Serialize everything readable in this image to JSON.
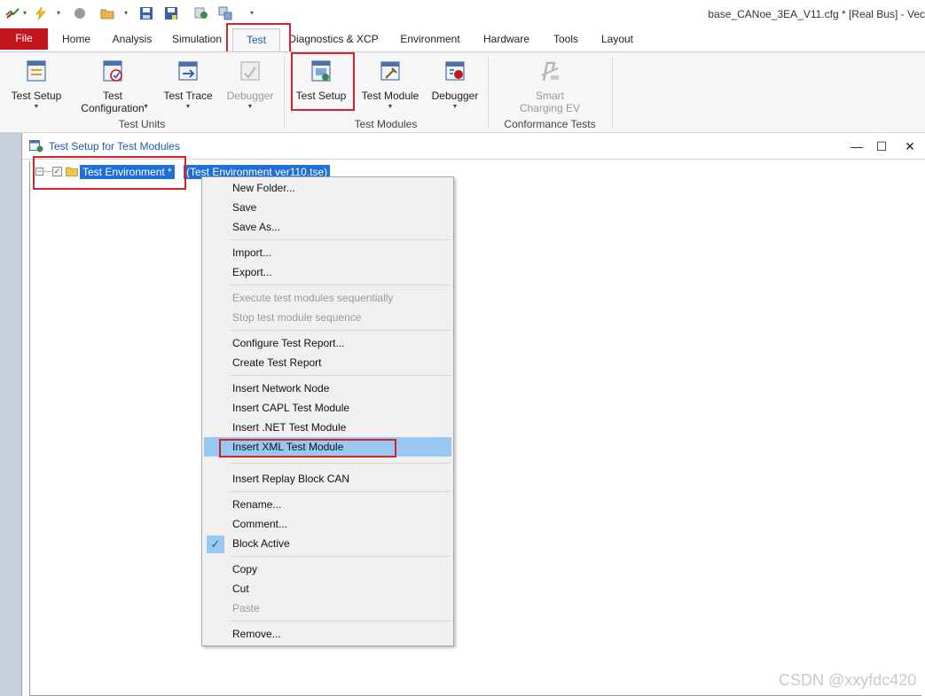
{
  "window_title": "base_CANoe_3EA_V11.cfg * [Real Bus] - Vec",
  "quick_access": [
    {
      "icon": "canoe-logo-icon"
    },
    {
      "icon": "lightning-icon"
    },
    {
      "icon": "record-stop-icon"
    },
    {
      "icon": "open-folder-icon"
    },
    {
      "icon": "save-icon"
    },
    {
      "icon": "save-as-icon"
    },
    {
      "icon": "database-icon"
    },
    {
      "icon": "configure-icon"
    }
  ],
  "menu_tabs": {
    "file": "File",
    "home": "Home",
    "analysis": "Analysis",
    "simulation": "Simulation",
    "test": "Test",
    "diagnostics": "Diagnostics & XCP",
    "environment": "Environment",
    "hardware": "Hardware",
    "tools": "Tools",
    "layout": "Layout",
    "active": "Test"
  },
  "ribbon": {
    "test_units": {
      "group_label": "Test Units",
      "test_setup": "Test Setup",
      "test_configuration_1": "Test",
      "test_configuration_2": "Configuration",
      "test_trace": "Test Trace",
      "debugger": "Debugger"
    },
    "test_modules": {
      "group_label": "Test Modules",
      "test_setup": "Test Setup",
      "test_module": "Test Module",
      "debugger": "Debugger"
    },
    "conformance": {
      "group_label": "Conformance Tests",
      "smart_charging_1": "Smart",
      "smart_charging_2": "Charging EV"
    }
  },
  "panel": {
    "title": "Test Setup for Test Modules",
    "minimize": "—",
    "maximize": "☐",
    "close": "✕"
  },
  "tree": {
    "expander": "−",
    "checked": true,
    "node_label": "Test Environment *",
    "node_file": "(Test Environment ver110.tse)"
  },
  "context_menu": {
    "items": [
      {
        "label": "New Folder...",
        "enabled": true
      },
      {
        "label": "Save",
        "enabled": true
      },
      {
        "label": "Save As...",
        "enabled": true
      },
      {
        "label": "Import...",
        "enabled": true
      },
      {
        "label": "Export...",
        "enabled": true
      },
      {
        "label": "Execute test modules sequentially",
        "enabled": false
      },
      {
        "label": "Stop test module sequence",
        "enabled": false
      },
      {
        "label": "Configure Test Report...",
        "enabled": true
      },
      {
        "label": "Create Test Report",
        "enabled": true
      },
      {
        "label": "Insert Network Node",
        "enabled": true
      },
      {
        "label": "Insert CAPL Test Module",
        "enabled": true
      },
      {
        "label": "Insert .NET Test Module",
        "enabled": true
      },
      {
        "label": "Insert XML Test Module",
        "enabled": true,
        "highlighted": true
      },
      {
        "label": "Insert Replay Block CAN",
        "enabled": true
      },
      {
        "label": "Rename...",
        "enabled": true
      },
      {
        "label": "Comment...",
        "enabled": true
      },
      {
        "label": "Block Active",
        "enabled": true,
        "checked": true
      },
      {
        "label": "Copy",
        "enabled": true
      },
      {
        "label": "Cut",
        "enabled": true
      },
      {
        "label": "Paste",
        "enabled": false
      },
      {
        "label": "Remove...",
        "enabled": true
      }
    ]
  },
  "watermark": "CSDN @xxyfdc420",
  "colors": {
    "file_tab": "#c4171d",
    "active_tab_text": "#1a5aa6",
    "selection": "#1e6fd6",
    "menu_highlight": "#99c9f2",
    "annotation_box": "#d8222a"
  }
}
